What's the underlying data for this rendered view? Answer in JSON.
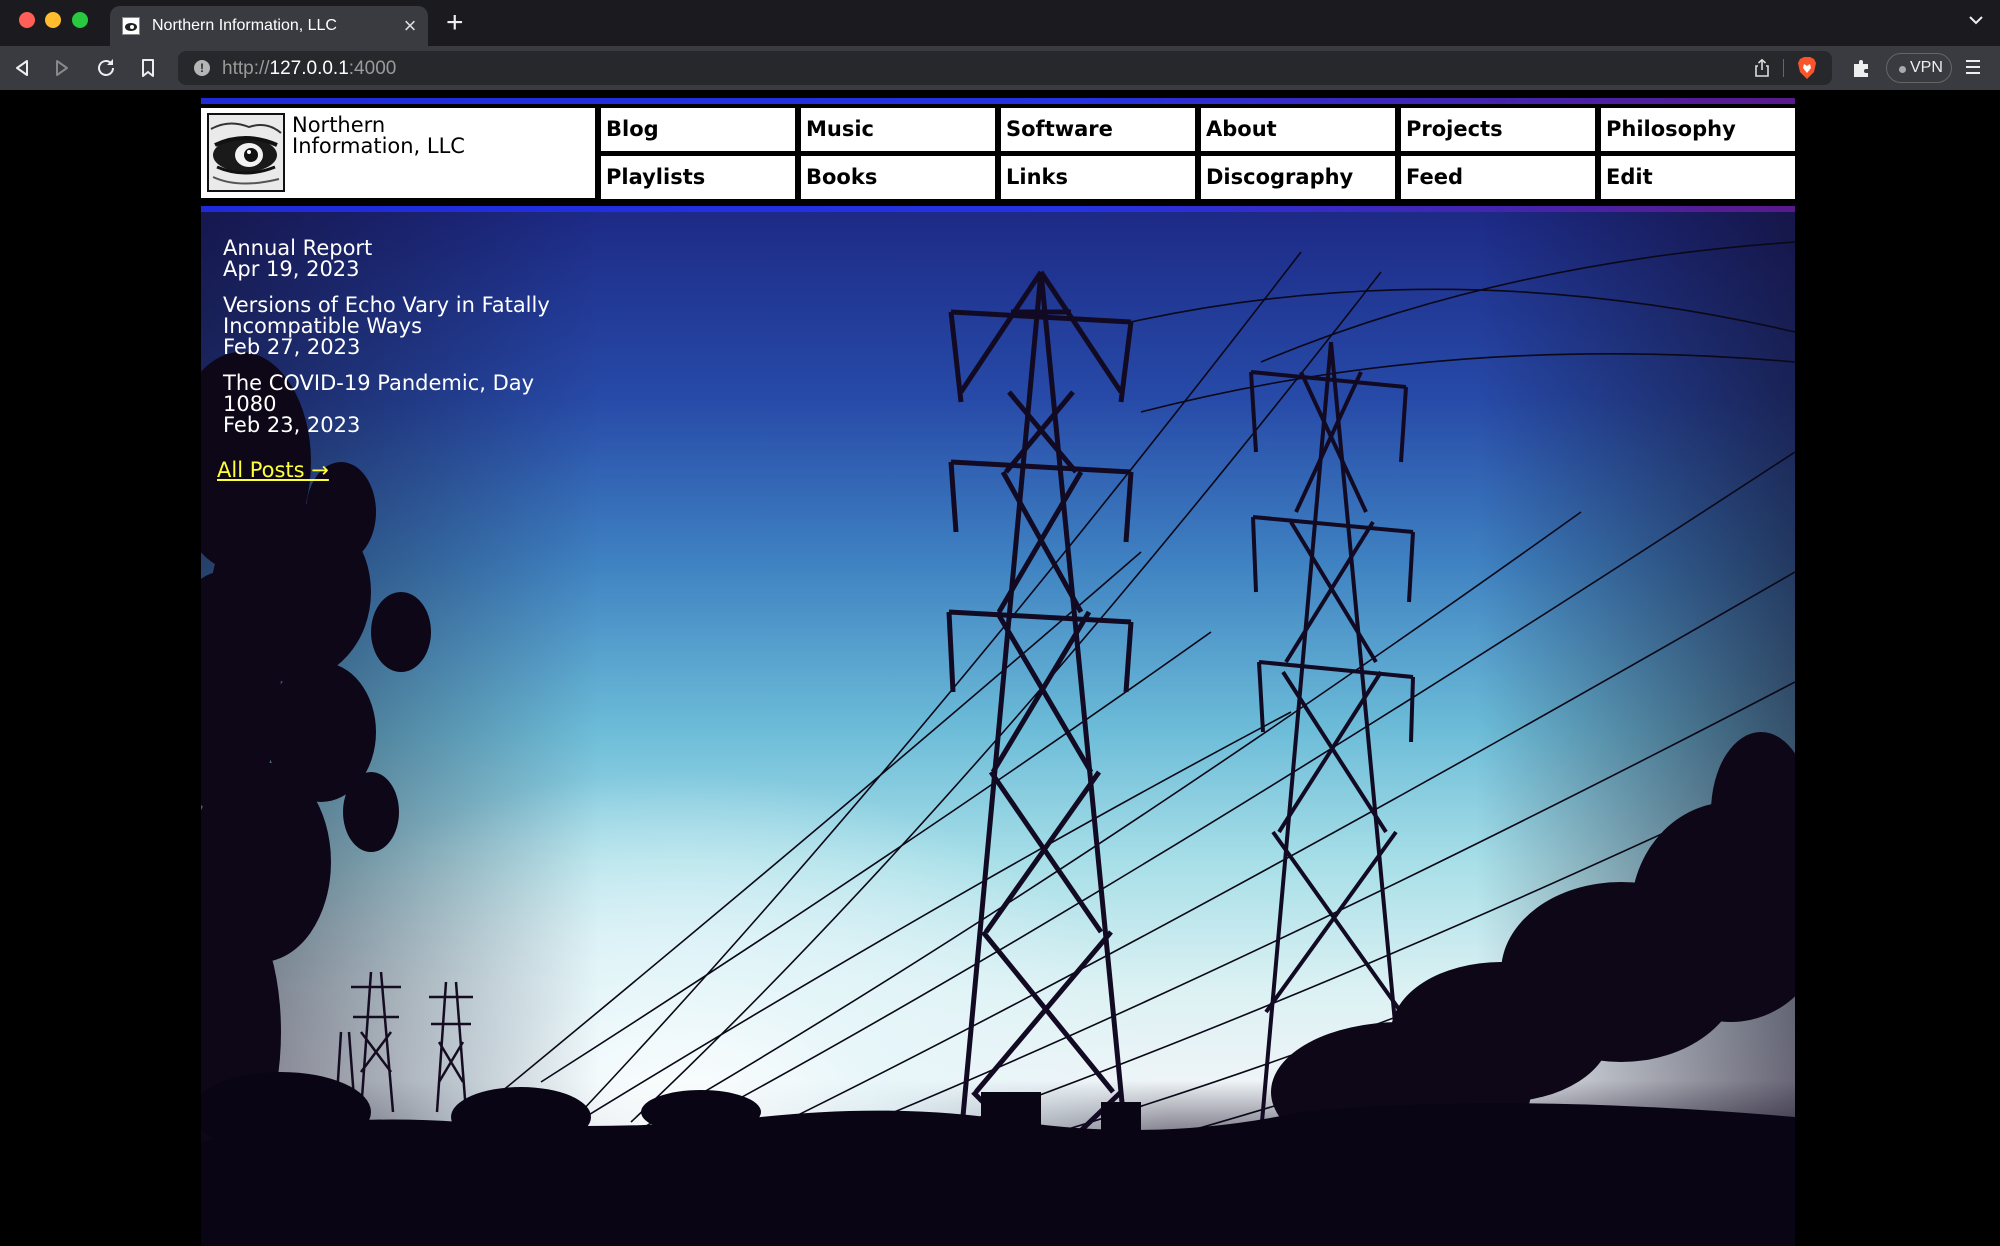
{
  "browser": {
    "tab_title": "Northern Information, LLC",
    "url_scheme": "http://",
    "url_host": "127.0.0.1",
    "url_port": ":4000",
    "vpn_label": "VPN"
  },
  "site": {
    "name": "Northern Information, LLC",
    "nav": {
      "row1": [
        "Blog",
        "Music",
        "Software",
        "About",
        "Projects",
        "Philosophy"
      ],
      "row2": [
        "Playlists",
        "Books",
        "Links",
        "Discography",
        "Feed",
        "Edit"
      ]
    },
    "posts": [
      {
        "title": "Annual Report",
        "date": "Apr 19, 2023"
      },
      {
        "title": "Versions of Echo Vary in Fatally Incompatible Ways",
        "date": "Feb 27, 2023"
      },
      {
        "title": "The COVID-19 Pandemic, Day 1080",
        "date": "Feb 23, 2023"
      }
    ],
    "all_posts_label": "All Posts →",
    "colors": {
      "stripe_start": "#1f2bd9",
      "stripe_end": "#5a1a8c",
      "link_yellow": "#ffff35"
    }
  }
}
